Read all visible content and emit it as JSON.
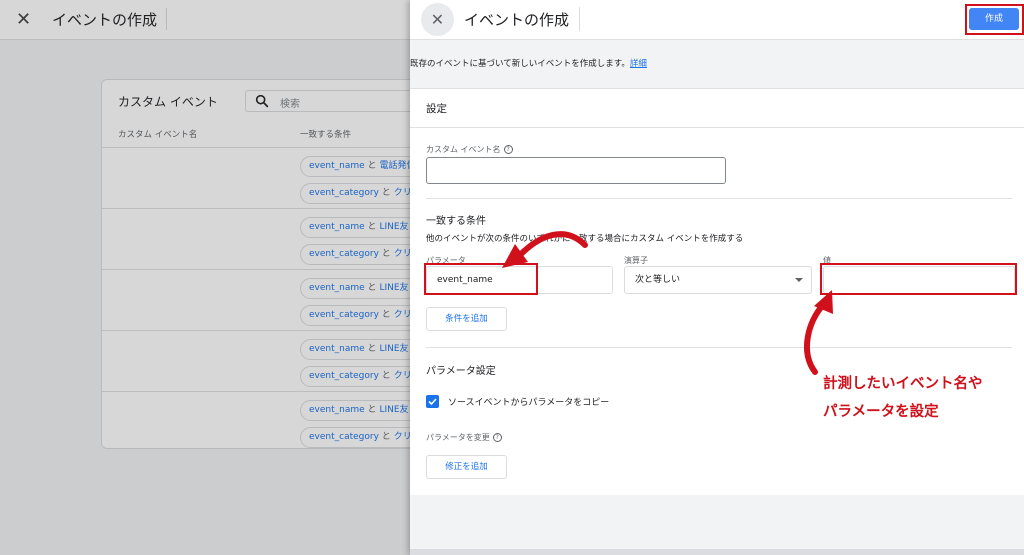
{
  "background": {
    "title": "イベントの作成",
    "card_title": "カスタム イベント",
    "search_placeholder": "検索",
    "col_name": "カスタム イベント名",
    "col_condition": "一致する条件",
    "rows": [
      {
        "c1_key": "event_name",
        "c1_op": "と",
        "c1_val": "電話発信",
        "c2_key": "event_category",
        "c2_op": "と",
        "c2_val": "クリ"
      },
      {
        "c1_key": "event_name",
        "c1_op": "と",
        "c1_val": "LINE友",
        "c2_key": "event_category",
        "c2_op": "と",
        "c2_val": "クリ"
      },
      {
        "c1_key": "event_name",
        "c1_op": "と",
        "c1_val": "LINE友",
        "c2_key": "event_category",
        "c2_op": "と",
        "c2_val": "クリ"
      },
      {
        "c1_key": "event_name",
        "c1_op": "と",
        "c1_val": "LINE友",
        "c2_key": "event_category",
        "c2_op": "と",
        "c2_val": "クリ"
      },
      {
        "c1_key": "event_name",
        "c1_op": "と",
        "c1_val": "LINE友",
        "c2_key": "event_category",
        "c2_op": "と",
        "c2_val": "クリ"
      }
    ]
  },
  "panel": {
    "title": "イベントの作成",
    "create_label": "作成",
    "description": "既存のイベントに基づいて新しいイベントを作成します。",
    "details_link": "詳細",
    "settings_title": "設定",
    "custom_event_name_label": "カスタム イベント名",
    "custom_event_name_value": "",
    "conditions_title": "一致する条件",
    "conditions_desc": "他のイベントが次の条件のいずれかに一致する場合にカスタム イベントを作成する",
    "param_label": "パラメータ",
    "param_value": "event_name",
    "operator_label": "演算子",
    "operator_value": "次と等しい",
    "value_label": "値",
    "value_value": "",
    "add_condition_label": "条件を追加",
    "param_settings_title": "パラメータ設定",
    "copy_params_label": "ソースイベントからパラメータをコピー",
    "copy_params_checked": true,
    "modify_params_label": "パラメータを変更",
    "add_modification_label": "修正を追加"
  },
  "annotation": {
    "line1": "計測したいイベント名や",
    "line2": "パラメータを設定",
    "color": "#d0101b"
  }
}
